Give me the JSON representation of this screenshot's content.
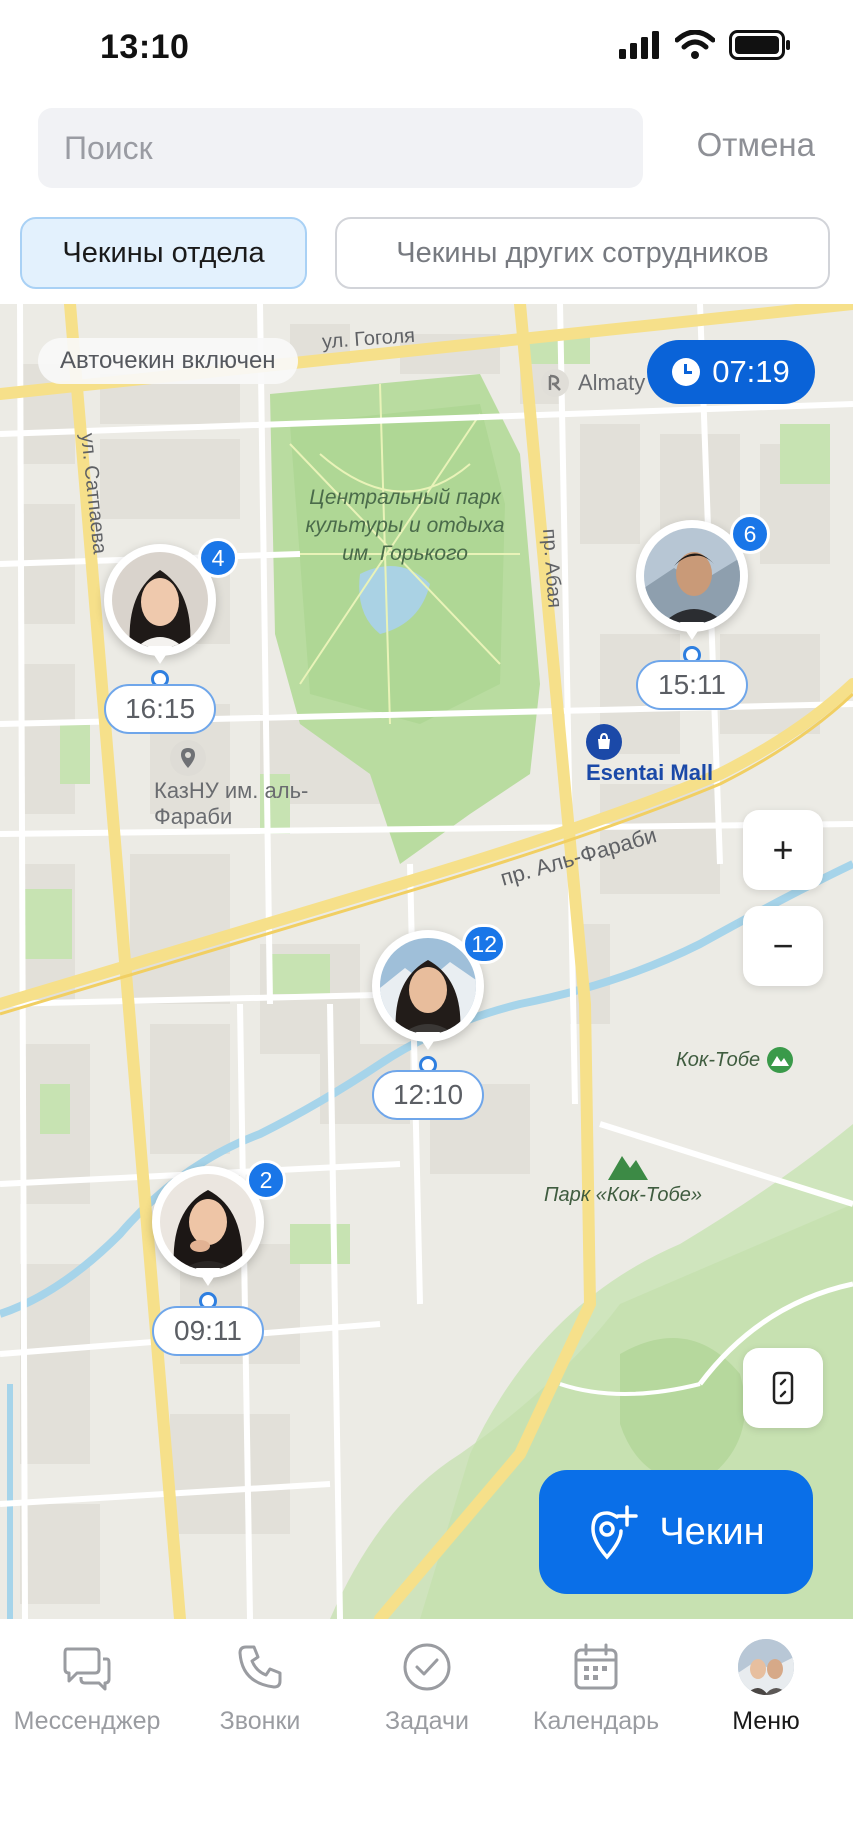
{
  "status_bar": {
    "time": "13:10"
  },
  "search": {
    "placeholder": "Поиск",
    "cancel_label": "Отмена"
  },
  "tabs": [
    {
      "label": "Чекины отдела",
      "active": true
    },
    {
      "label": "Чекины других сотрудников",
      "active": false
    }
  ],
  "map": {
    "autocheck_label": "Авточекин включен",
    "current_time": "07:19",
    "streets": {
      "gogolya": "ул. Гоголя",
      "satpaeva": "ул. Сатпаева",
      "abaya": "пр. Абая",
      "al_farabi": "пр. Аль-Фараби"
    },
    "park_label": "Центральный парк культуры и отдыха им. Горького",
    "theatre_label": "Almaty Theatre",
    "mall_label": "Esentai Mall",
    "kaznu_label": "КазНУ им. аль-Фараби",
    "koktobe_label": "Кок-Тобе",
    "koktobe_park_label": "Парк «Кок-Тобе»",
    "zoom_in_label": "+",
    "zoom_out_label": "−"
  },
  "pins": [
    {
      "count": "4",
      "time": "16:15"
    },
    {
      "count": "6",
      "time": "15:11"
    },
    {
      "count": "12",
      "time": "12:10"
    },
    {
      "count": "2",
      "time": "09:11"
    }
  ],
  "checkin_button": {
    "label": "Чекин"
  },
  "nav": [
    {
      "label": "Мессенджер",
      "icon": "chat-icon"
    },
    {
      "label": "Звонки",
      "icon": "phone-icon"
    },
    {
      "label": "Задачи",
      "icon": "check-circle-icon"
    },
    {
      "label": "Календарь",
      "icon": "calendar-icon"
    },
    {
      "label": "Меню",
      "icon": "avatar",
      "active": true
    }
  ],
  "colors": {
    "accent": "#0a6fe8",
    "pin_badge": "#1976e8",
    "park": "#b9dca0"
  }
}
